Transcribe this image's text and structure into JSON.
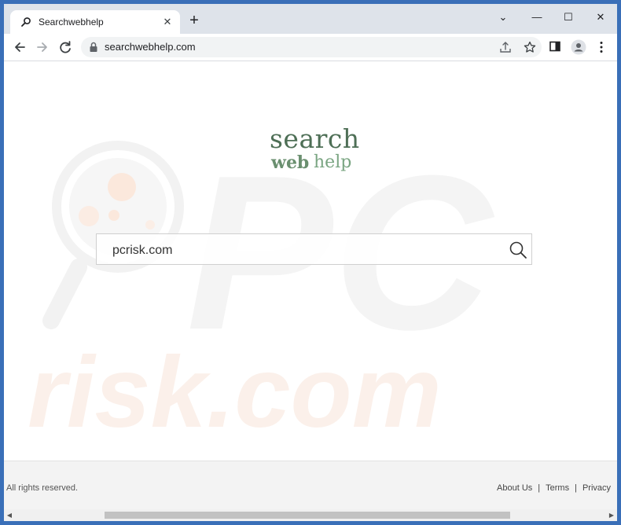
{
  "browser": {
    "tab_title": "Searchwebhelp",
    "new_tab_label": "+",
    "url": "searchwebhelp.com",
    "window_controls": {
      "minimize": "⌄",
      "restore": "—",
      "maximize": "☐",
      "close": "✕"
    }
  },
  "logo": {
    "line1": "search",
    "web": "web",
    "help": "help"
  },
  "search": {
    "value": "pcrisk.com"
  },
  "footer": {
    "rights": "All rights reserved.",
    "links": [
      "About Us",
      "Terms",
      "Privacy"
    ],
    "separator": "|"
  },
  "watermark": {
    "text": "risk.com",
    "letters": "PC"
  },
  "icons": {
    "tab": "search-icon",
    "close": "close-icon",
    "back": "back-arrow-icon",
    "forward": "forward-arrow-icon",
    "reload": "reload-icon",
    "lock": "lock-icon",
    "share": "share-icon",
    "bookmark": "star-icon",
    "sidepanel": "side-panel-icon",
    "profile": "profile-icon",
    "menu": "kebab-menu-icon",
    "search_button": "magnifier-icon"
  },
  "colors": {
    "accent_green": "#4e6f56",
    "frame": "#dee3ea",
    "watermark": "#f7e6dc"
  }
}
